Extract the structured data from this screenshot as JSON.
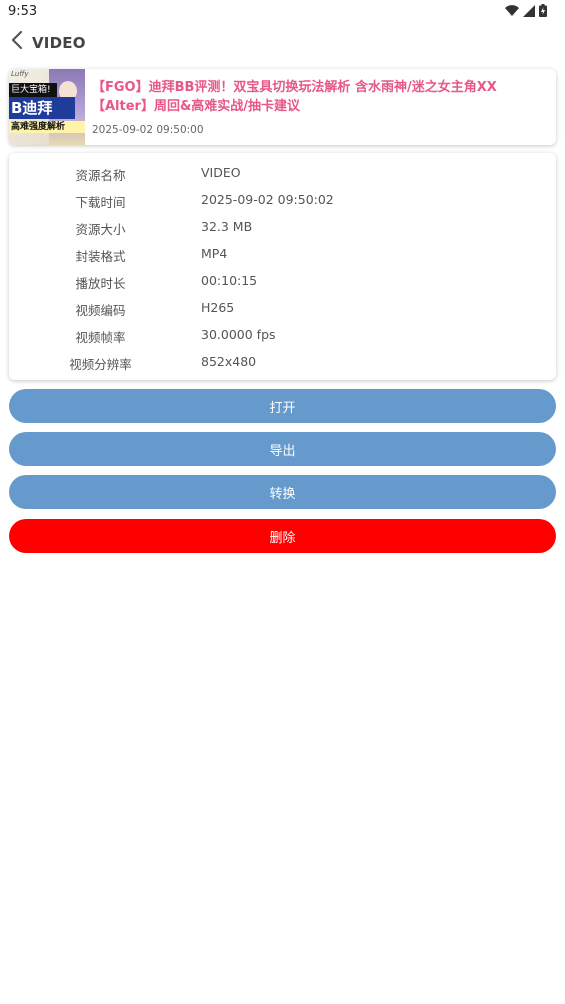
{
  "status_bar": {
    "time": "9:53"
  },
  "header": {
    "title": "VIDEO"
  },
  "video": {
    "title": "【FGO】迪拜BB评测！双宝具切换玩法解析 含水雨神/迷之女主角XX【Alter】周回&高难实战/抽卡建议",
    "date": "2025-09-02 09:50:00",
    "thumbnail_text": [
      "巨大宝箱!",
      "B迪拜",
      "高难强度解析"
    ]
  },
  "info": [
    {
      "label": "资源名称",
      "value": "VIDEO"
    },
    {
      "label": "下载时间",
      "value": "2025-09-02 09:50:02"
    },
    {
      "label": "资源大小",
      "value": "32.3 MB"
    },
    {
      "label": "封装格式",
      "value": "MP4"
    },
    {
      "label": "播放时长",
      "value": "00:10:15"
    },
    {
      "label": "视频编码",
      "value": "H265"
    },
    {
      "label": "视频帧率",
      "value": "30.0000 fps"
    },
    {
      "label": "视频分辨率",
      "value": "852x480"
    }
  ],
  "actions": {
    "open": "打开",
    "export": "导出",
    "convert": "转换",
    "delete": "删除"
  },
  "colors": {
    "accent": "#6699cc",
    "danger": "#ff0000",
    "title_pink": "#e8568a"
  }
}
